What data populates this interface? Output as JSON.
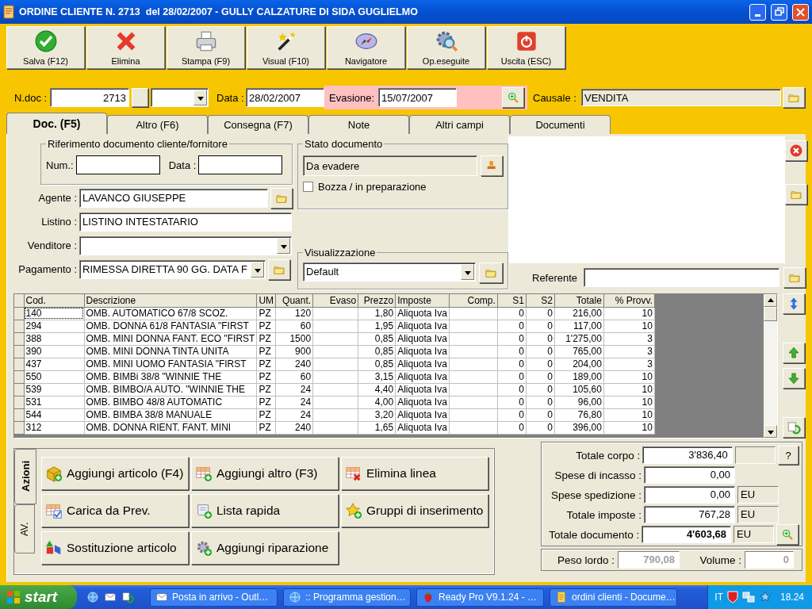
{
  "window": {
    "title": "ORDINE CLIENTE N. 2713  del 28/02/2007 - GULLY CALZATURE DI SIDA GUGLIELMO"
  },
  "toolbar": [
    {
      "label": "Salva (F12)",
      "kind": "check"
    },
    {
      "label": "Elimina",
      "kind": "cross"
    },
    {
      "label": "Stampa (F9)",
      "kind": "printer"
    },
    {
      "label": "Visual (F10)",
      "kind": "wand"
    },
    {
      "label": "Navigatore",
      "kind": "compass"
    },
    {
      "label": "Op.eseguite",
      "kind": "gears"
    },
    {
      "label": "Uscita (ESC)",
      "kind": "power"
    }
  ],
  "header": {
    "ndoc_label": "N.doc :",
    "ndoc": "2713",
    "data_label": "Data :",
    "data": "28/02/2007",
    "evasione_label": "Evasione:",
    "evasione": "15/07/2007",
    "causale_label": "Causale :",
    "causale": "VENDITA"
  },
  "tabs": [
    {
      "label": "Doc. (F5)",
      "selected": true
    },
    {
      "label": "Altro (F6)",
      "selected": false
    },
    {
      "label": "Consegna (F7)",
      "selected": false
    },
    {
      "label": "Note",
      "selected": false
    },
    {
      "label": "Altri campi",
      "selected": false
    },
    {
      "label": "Documenti",
      "selected": false
    }
  ],
  "riferimento": {
    "title": "Riferimento documento cliente/fornitore",
    "num_label": "Num.:",
    "data_label": "Data :"
  },
  "fields": [
    {
      "label": "Agente :",
      "value": "LAVANCO GIUSEPPE",
      "kind": "folder"
    },
    {
      "label": "Listino :",
      "value": "LISTINO INTESTATARIO",
      "kind": "plain"
    },
    {
      "label": "Venditore :",
      "kind": "dropdown"
    },
    {
      "label": "Pagamento :",
      "value": "RIMESSA DIRETTA 90 GG. DATA F",
      "kind": "dropdown-folder"
    }
  ],
  "stato": {
    "title": "Stato documento",
    "value": "Da evadere",
    "draft_label": "Bozza / in preparazione",
    "draft_checked": false
  },
  "visualizzazione": {
    "title": "Visualizzazione",
    "value": "Default"
  },
  "referente": {
    "label": "Referente"
  },
  "table": {
    "columns": [
      {
        "label": "Cod.",
        "kind": "data"
      },
      {
        "label": "Descrizione",
        "kind": "data"
      },
      {
        "label": "UM",
        "kind": "data"
      },
      {
        "label": "Quant.",
        "kind": "data"
      },
      {
        "label": "Evaso",
        "kind": "blank"
      },
      {
        "label": "Prezzo",
        "kind": "data"
      },
      {
        "label": "Imposte",
        "kind": "data"
      },
      {
        "label": "Comp.",
        "kind": "blank"
      },
      {
        "label": "S1",
        "kind": "data"
      },
      {
        "label": "S2",
        "kind": "data"
      },
      {
        "label": "Totale",
        "kind": "data"
      },
      {
        "label": "% Provv.",
        "kind": "data"
      }
    ],
    "rows": [
      {
        "cod": "140",
        "descrizione": "OMB. AUTOMATICO 67/8 SCOZ.",
        "um": "PZ",
        "quant": "120",
        "prezzo": "1,80",
        "imposte": "Aliquota Iva",
        "s1": "0",
        "s2": "0",
        "totale": "216,00",
        "provv": "10",
        "selected": true
      },
      {
        "cod": "294",
        "descrizione": "OMB. DONNA 61/8 FANTASIA \"FIRST",
        "um": "PZ",
        "quant": "60",
        "prezzo": "1,95",
        "imposte": "Aliquota Iva",
        "s1": "0",
        "s2": "0",
        "totale": "117,00",
        "provv": "10",
        "selected": false
      },
      {
        "cod": "388",
        "descrizione": "OMB. MINI DONNA FANT. ECO \"FIRST",
        "um": "PZ",
        "quant": "1500",
        "prezzo": "0,85",
        "imposte": "Aliquota Iva",
        "s1": "0",
        "s2": "0",
        "totale": "1'275,00",
        "provv": "3",
        "selected": false
      },
      {
        "cod": "390",
        "descrizione": "OMB. MINI DONNA TINTA UNITA",
        "um": "PZ",
        "quant": "900",
        "prezzo": "0,85",
        "imposte": "Aliquota Iva",
        "s1": "0",
        "s2": "0",
        "totale": "765,00",
        "provv": "3",
        "selected": false
      },
      {
        "cod": "437",
        "descrizione": "OMB. MINI UOMO FANTASIA \"FIRST",
        "um": "PZ",
        "quant": "240",
        "prezzo": "0,85",
        "imposte": "Aliquota Iva",
        "s1": "0",
        "s2": "0",
        "totale": "204,00",
        "provv": "3",
        "selected": false
      },
      {
        "cod": "550",
        "descrizione": "OMB. BIMBi 38/8  \"WINNIE THE",
        "um": "PZ",
        "quant": "60",
        "prezzo": "3,15",
        "imposte": "Aliquota Iva",
        "s1": "0",
        "s2": "0",
        "totale": "189,00",
        "provv": "10",
        "selected": false
      },
      {
        "cod": "539",
        "descrizione": "OMB. BIMBO/A AUTO. \"WINNIE THE",
        "um": "PZ",
        "quant": "24",
        "prezzo": "4,40",
        "imposte": "Aliquota Iva",
        "s1": "0",
        "s2": "0",
        "totale": "105,60",
        "provv": "10",
        "selected": false
      },
      {
        "cod": "531",
        "descrizione": "OMB. BIMBO 48/8 AUTOMATIC",
        "um": "PZ",
        "quant": "24",
        "prezzo": "4,00",
        "imposte": "Aliquota Iva",
        "s1": "0",
        "s2": "0",
        "totale": "96,00",
        "provv": "10",
        "selected": false
      },
      {
        "cod": "544",
        "descrizione": "OMB. BIMBA 38/8 MANUALE",
        "um": "PZ",
        "quant": "24",
        "prezzo": "3,20",
        "imposte": "Aliquota Iva",
        "s1": "0",
        "s2": "0",
        "totale": "76,80",
        "provv": "10",
        "selected": false
      },
      {
        "cod": "312",
        "descrizione": "OMB. DONNA RIENT. FANT. MINI",
        "um": "PZ",
        "quant": "240",
        "prezzo": "1,65",
        "imposte": "Aliquota Iva",
        "s1": "0",
        "s2": "0",
        "totale": "396,00",
        "provv": "10",
        "selected": false
      }
    ]
  },
  "action_tabs": [
    {
      "label": "Azioni",
      "selected": true
    },
    {
      "label": "AV.",
      "selected": false
    }
  ],
  "actions": [
    {
      "label": "Aggiungi articolo (F4)",
      "kind": "cube"
    },
    {
      "label": "Aggiungi altro (F3)",
      "kind": "grid-add"
    },
    {
      "label": "Elimina linea",
      "kind": "grid-del"
    },
    {
      "label": "Carica da Prev.",
      "kind": "grid-check"
    },
    {
      "label": "Lista rapida",
      "kind": "scroll"
    },
    {
      "label": "Gruppi di inserimento",
      "kind": "star"
    },
    {
      "label": "Sostituzione articolo",
      "kind": "shapes"
    },
    {
      "label": "Aggiungi riparazione",
      "kind": "gear"
    }
  ],
  "totals": [
    {
      "label": "Totale corpo :",
      "value": "3'836,40",
      "kind": "help",
      "help_label": "?",
      "bold": false
    },
    {
      "label": "Spese di incasso :",
      "value": "0,00",
      "kind": "plain",
      "bold": false
    },
    {
      "label": "Spese spedizione :",
      "value": "0,00",
      "unit": "EU",
      "kind": "unit",
      "bold": false
    },
    {
      "label": "Totale imposte :",
      "value": "767,28",
      "unit": "EU",
      "kind": "unit",
      "bold": false
    },
    {
      "label": "Totale documento :",
      "value": "4'603,68",
      "unit": "EU",
      "kind": "zoom",
      "bold": true
    }
  ],
  "weights": {
    "peso_label": "Peso lordo :",
    "peso": "790,08",
    "volume_label": "Volume :",
    "volume": "0"
  },
  "taskbar": {
    "start": "start",
    "tasks": [
      {
        "label": "Posta in arrivo - Outl…",
        "kind": "mail"
      },
      {
        "label": ":: Programma gestion…",
        "kind": "browser"
      },
      {
        "label": "Ready Pro V9.1.24 - …",
        "kind": "strawberry"
      },
      {
        "label": "ordini clienti - Docume…",
        "kind": "doc"
      }
    ],
    "lang": "IT",
    "clock": "18.24"
  }
}
